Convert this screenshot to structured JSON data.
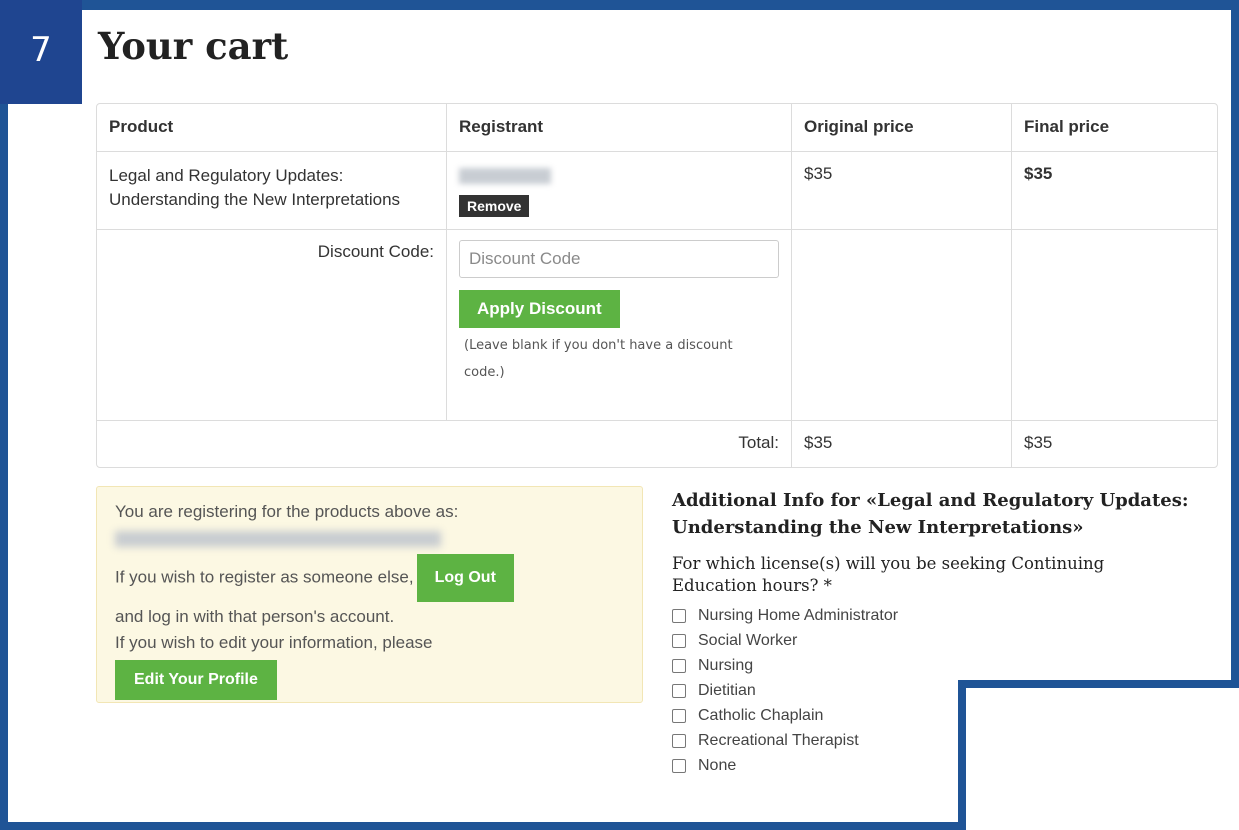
{
  "step_number": "7",
  "page_title": "Your cart",
  "cart": {
    "headers": [
      "Product",
      "Registrant",
      "Original price",
      "Final price"
    ],
    "item": {
      "product": "Legal and Regulatory Updates: Understanding the New Interpretations",
      "remove_label": "Remove",
      "original_price": "$35",
      "final_price": "$35"
    },
    "discount": {
      "label": "Discount Code:",
      "placeholder": "Discount Code",
      "apply_label": "Apply Discount",
      "note": "(Leave blank if you don't have a discount code.)"
    },
    "total": {
      "label": "Total:",
      "original": "$35",
      "final": "$35"
    }
  },
  "registering": {
    "line1": "You are registering for the products above as:",
    "line2": "If you wish to register as someone else,",
    "logout_label": "Log Out",
    "line3": "and log in with that person's account.",
    "line4": "If you wish to edit your information, please",
    "edit_label": "Edit Your Profile"
  },
  "additional_info": {
    "title": "Additional Info for «Legal and Regulatory Updates: Understanding the New Interpretations»",
    "question": "For which license(s) will you be seeking Continuing Education hours? *",
    "options": [
      "Nursing Home Administrator",
      "Social Worker",
      "Nursing",
      "Dietitian",
      "Catholic Chaplain",
      "Recreational Therapist",
      "None"
    ]
  },
  "colors": {
    "frame": "#1f5496",
    "accent_green": "#5db343",
    "notice_bg": "#fcf8e3"
  }
}
